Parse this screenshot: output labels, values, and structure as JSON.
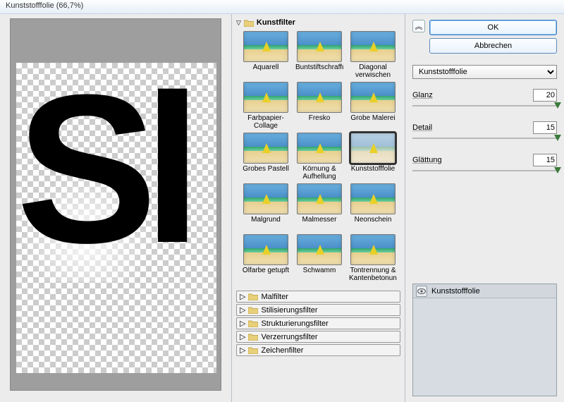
{
  "window": {
    "title": "Kunststofffolie (66,7%)"
  },
  "filters": {
    "open_category": "Kunstfilter",
    "items": [
      "Aquarell",
      "Buntstiftschraffur",
      "Diagonal verwischen",
      "Farbpapier-Collage",
      "Fresko",
      "Grobe Malerei",
      "Grobes Pastell",
      "Körnung & Aufhellung",
      "Kunststofffolie",
      "Malgrund",
      "Malmesser",
      "Neonschein",
      "Ölfarbe getupft",
      "Schwamm",
      "Tontrennung & Kantenbetonung"
    ],
    "selected_index": 8,
    "closed_categories": [
      "Malfilter",
      "Stilisierungsfilter",
      "Strukturierungsfilter",
      "Verzerrungsfilter",
      "Zeichenfilter"
    ]
  },
  "buttons": {
    "ok": "OK",
    "cancel": "Abbrechen"
  },
  "dropdown": {
    "selected": "Kunststofffolie"
  },
  "params": {
    "glanz": {
      "label": "Glanz",
      "value": "20",
      "pos": 98
    },
    "detail": {
      "label": "Detail",
      "value": "15",
      "pos": 98
    },
    "glaettung": {
      "label": "Glättung",
      "value": "15",
      "pos": 98
    }
  },
  "layer": {
    "name": "Kunststofffolie"
  },
  "chart_data": null
}
